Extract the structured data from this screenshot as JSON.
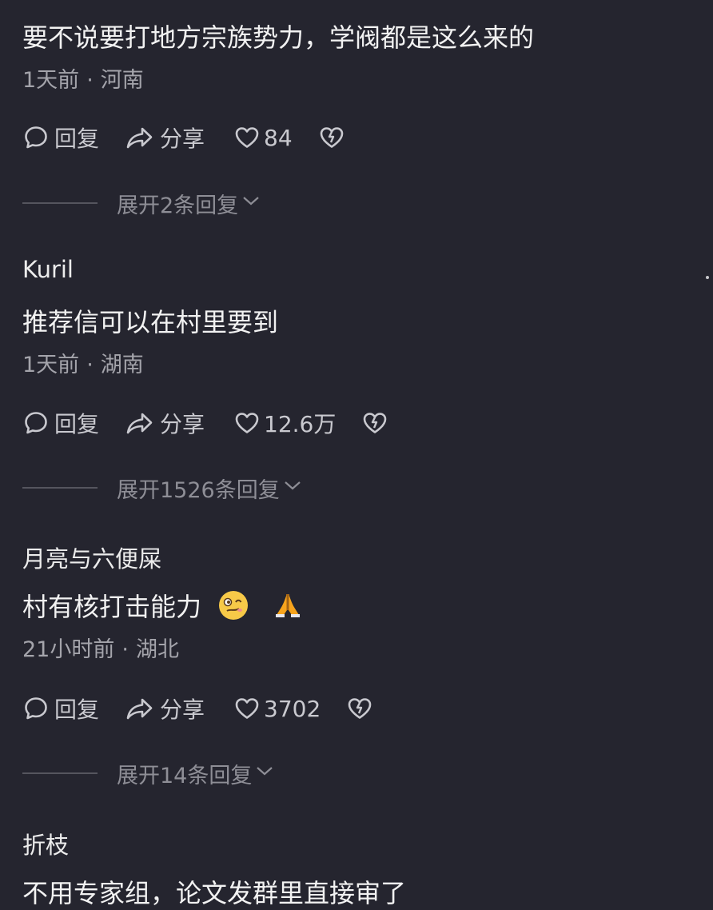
{
  "comments": [
    {
      "username": "",
      "text": "要不说要打地方宗族势力，学阀都是这么来的",
      "time": "1天前",
      "separator": "·",
      "location": "河南",
      "reply_label": "回复",
      "share_label": "分享",
      "likes": "84",
      "expand_label": "展开2条回复"
    },
    {
      "username": "Kuril",
      "text": "推荐信可以在村里要到",
      "time": "1天前",
      "separator": "·",
      "location": "湖南",
      "reply_label": "回复",
      "share_label": "分享",
      "likes": "12.6万",
      "expand_label": "展开1526条回复"
    },
    {
      "username": "月亮与六便屎",
      "text": "村有核打击能力",
      "emojis": [
        "woozy-face-emoji",
        "folded-hands-emoji"
      ],
      "time": "21小时前",
      "separator": "·",
      "location": "湖北",
      "reply_label": "回复",
      "share_label": "分享",
      "likes": "3702",
      "expand_label": "展开14条回复"
    },
    {
      "username": "折枝",
      "text": "不用专家组，论文发群里直接审了"
    }
  ],
  "icons": {
    "reply": "comment-bubble-icon",
    "share": "share-arrow-icon",
    "like": "heart-icon",
    "dislike": "broken-heart-icon",
    "expand": "chevron-down-icon"
  },
  "colors": {
    "background": "#25252f",
    "primary_text": "#f2f2f2",
    "meta_text": "#a4a4ab",
    "action_text": "#c9c9cf",
    "expand_text": "#8e8e96"
  }
}
